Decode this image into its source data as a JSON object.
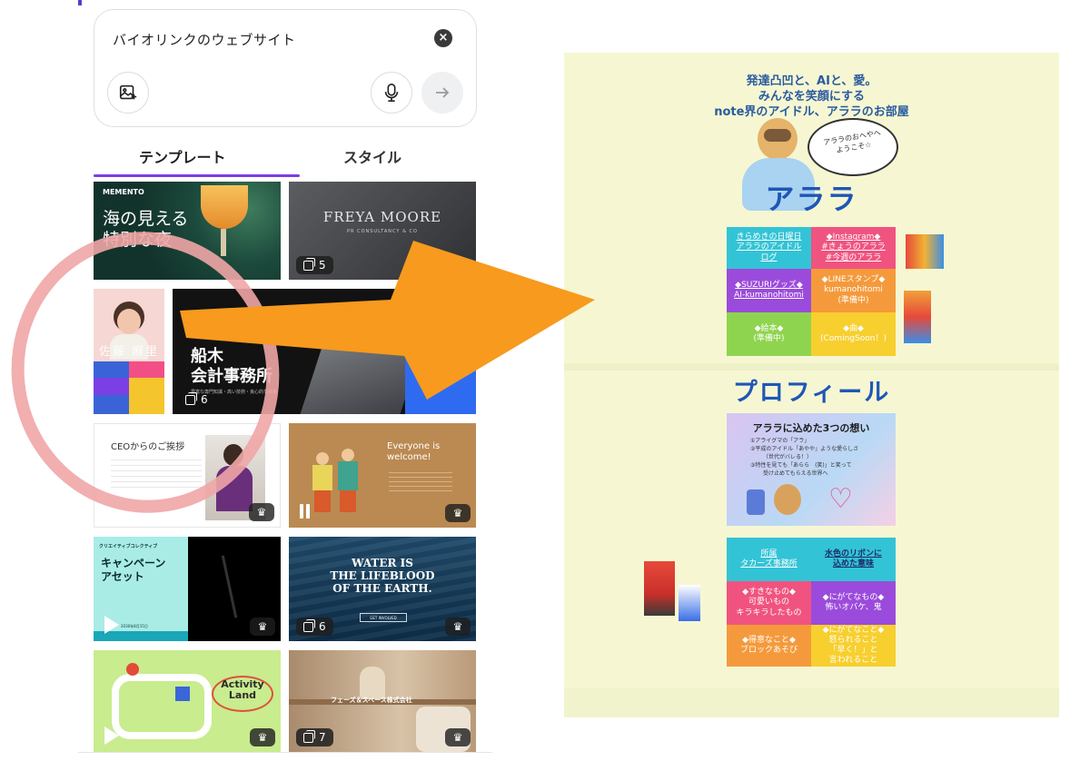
{
  "app": {
    "search": {
      "value": "バイオリンクのウェブサイト"
    },
    "tabs": [
      {
        "label": "テンプレート",
        "active": true
      },
      {
        "label": "スタイル",
        "active": false
      }
    ],
    "accent_color": "#7b3fe4",
    "templates": {
      "memento": {
        "brand": "MEMENTO",
        "headline": "海の見える\n特別な夜"
      },
      "freya": {
        "title": "FREYA MOORE",
        "subtitle": "PR CONSULTANCY & CO",
        "count": "5"
      },
      "sato": {
        "name": "佐藤 麻里"
      },
      "funaki": {
        "title": "船木\n会計事務所",
        "tagline": "豊富な専門知識・高い技術・良心的な価格",
        "count": "6"
      },
      "ceo": {
        "title": "CEOからのご挨拶"
      },
      "everyone": {
        "title": "Everyone is\nwelcome!"
      },
      "campaign": {
        "brand": "クリエイティブコレクティブ",
        "title": "キャンペーン\nアセット",
        "date": "2030年8月15日"
      },
      "water": {
        "title": "WATER IS\nTHE LIFEBLOOD\nOF THE EARTH.",
        "button": "GET INVOLVED",
        "count": "6"
      },
      "activity": {
        "title": "Activity\nLand"
      },
      "phase": {
        "brand": "フェーズ＆スペース株式会社",
        "count": "7"
      }
    }
  },
  "site": {
    "background": "#f6f7d2",
    "header": [
      "発達凸凹と、AIと、愛。",
      "みんなを笑顔にする",
      "note界のアイドル、アララのお部屋"
    ],
    "speech": "アララのおへやへ\nようこそ☆",
    "logo": "アララ",
    "links": [
      {
        "text": "きらめきの日曜日\nアララのアイドル\nログ",
        "color": "#33c3d6"
      },
      {
        "text": "◆Instagram◆\n#きょうのアララ\n#今週のアララ",
        "color": "#f0537f"
      },
      {
        "text": "◆SUZURIグッズ◆\nAI-kumanohitomi",
        "color": "#9b4bdb"
      },
      {
        "text": "◆LINEスタンプ◆\nkumanohitomi\n(準備中)",
        "color": "#f59a3c"
      },
      {
        "text": "◆絵本◆\n(準備中)",
        "color": "#8fd44f"
      },
      {
        "text": "◆曲◆\n(ComingSoon！)",
        "color": "#f7cf2e"
      }
    ],
    "profile_heading": "プロフィール",
    "card": {
      "title": "アララに込めた3つの想い",
      "lines": [
        "①アライグマの「アラ」",
        "②平成のアイドル「あやや」ような愛らしさ",
        "（世代がバレる！）",
        "③特性を見ても「あらら　(笑)」と笑って",
        "受け止めてもらえる世界へ"
      ]
    },
    "profile": [
      {
        "text": "所属\nタカーズ事務所",
        "color": "#33c3d6"
      },
      {
        "text": "水色のリボンに\n込めた意味",
        "color": "#33c3d6"
      },
      {
        "text": "◆すきなもの◆\n可愛いもの\nキラキラしたもの",
        "color": "#f0537f"
      },
      {
        "text": "◆にがてなもの◆\n怖いオバケ、鬼",
        "color": "#9b4bdb"
      },
      {
        "text": "◆得意なこと◆\nブロックあそび",
        "color": "#f59a3c"
      },
      {
        "text": "◆にがてなこと◆\n怒られること\n「早く！」と\n言われること",
        "color": "#f7cf2e"
      }
    ]
  }
}
